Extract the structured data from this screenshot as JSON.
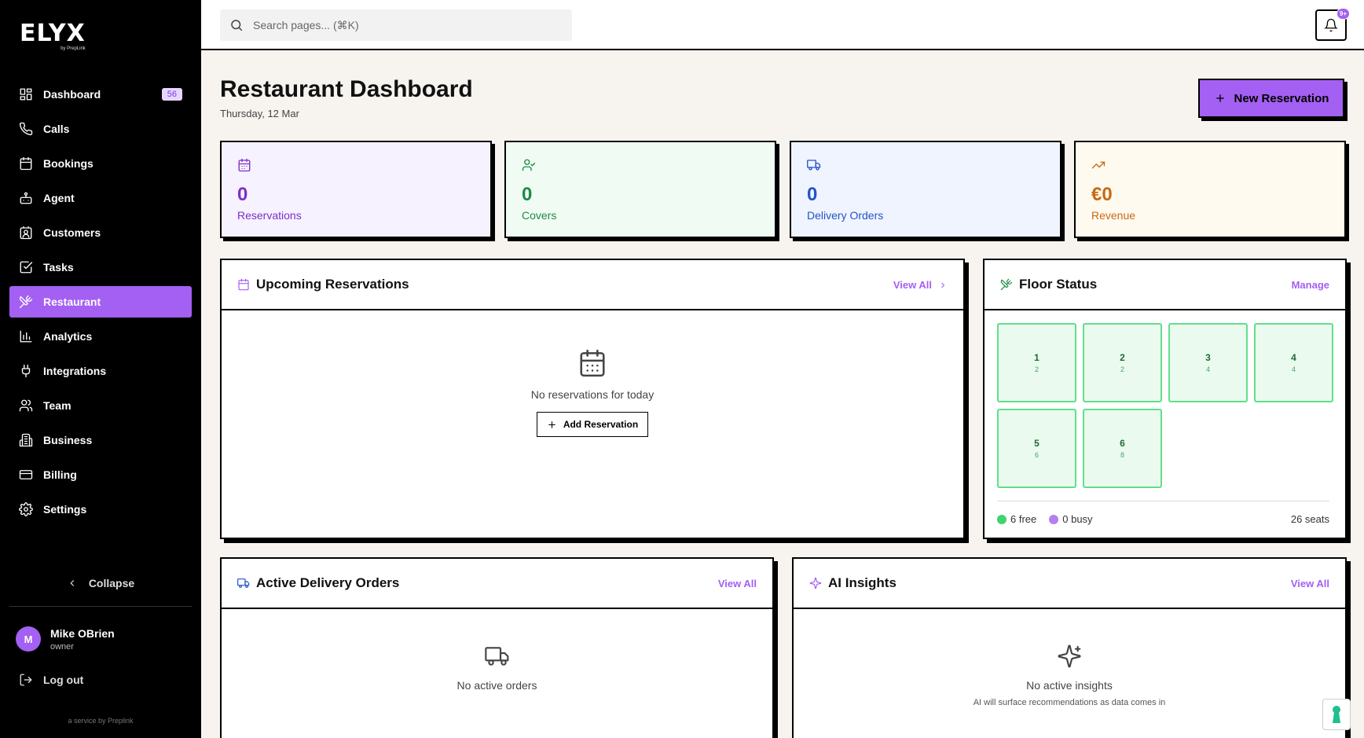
{
  "brand": {
    "name": "ELYX",
    "sub": "by PrepLink",
    "service": "a service by Preplink"
  },
  "sidebar": {
    "items": [
      {
        "label": "Dashboard",
        "badge": "56"
      },
      {
        "label": "Calls"
      },
      {
        "label": "Bookings"
      },
      {
        "label": "Agent"
      },
      {
        "label": "Customers"
      },
      {
        "label": "Tasks"
      },
      {
        "label": "Restaurant",
        "active": true
      },
      {
        "label": "Analytics"
      },
      {
        "label": "Integrations"
      },
      {
        "label": "Team"
      },
      {
        "label": "Business"
      },
      {
        "label": "Billing"
      },
      {
        "label": "Settings"
      }
    ],
    "collapse": "Collapse",
    "user": {
      "initial": "M",
      "name": "Mike OBrien",
      "role": "owner"
    },
    "logout": "Log out"
  },
  "topbar": {
    "search_placeholder": "Search pages... (⌘K)",
    "notif_badge": "9+"
  },
  "header": {
    "title": "Restaurant Dashboard",
    "date": "Thursday, 12 Mar",
    "new_button": "New Reservation"
  },
  "stats": [
    {
      "value": "0",
      "label": "Reservations",
      "color": "#7b2fc9",
      "bg": "#f7f2ff"
    },
    {
      "value": "0",
      "label": "Covers",
      "color": "#1e8a45",
      "bg": "#f0fbf3"
    },
    {
      "value": "0",
      "label": "Delivery Orders",
      "color": "#2452c8",
      "bg": "#eff4fe"
    },
    {
      "value": "€0",
      "label": "Revenue",
      "color": "#c76a10",
      "bg": "#fffaf0"
    }
  ],
  "upcoming": {
    "title": "Upcoming Reservations",
    "link": "View All",
    "empty": "No reservations for today",
    "add": "Add Reservation"
  },
  "floor": {
    "title": "Floor Status",
    "link": "Manage",
    "tables": [
      {
        "num": "1",
        "seats": "2"
      },
      {
        "num": "2",
        "seats": "2"
      },
      {
        "num": "3",
        "seats": "4"
      },
      {
        "num": "4",
        "seats": "4"
      },
      {
        "num": "5",
        "seats": "6"
      },
      {
        "num": "6",
        "seats": "8"
      }
    ],
    "free": "6 free",
    "busy": "0 busy",
    "seats": "26 seats"
  },
  "delivery": {
    "title": "Active Delivery Orders",
    "link": "View All",
    "empty": "No active orders"
  },
  "insights": {
    "title": "AI Insights",
    "link": "View All",
    "empty": "No active insights",
    "sub": "AI will surface recommendations as data comes in"
  },
  "colors": {
    "accent": "#a45ff3",
    "free": "#3ed46f",
    "busy": "#b77ef0"
  }
}
